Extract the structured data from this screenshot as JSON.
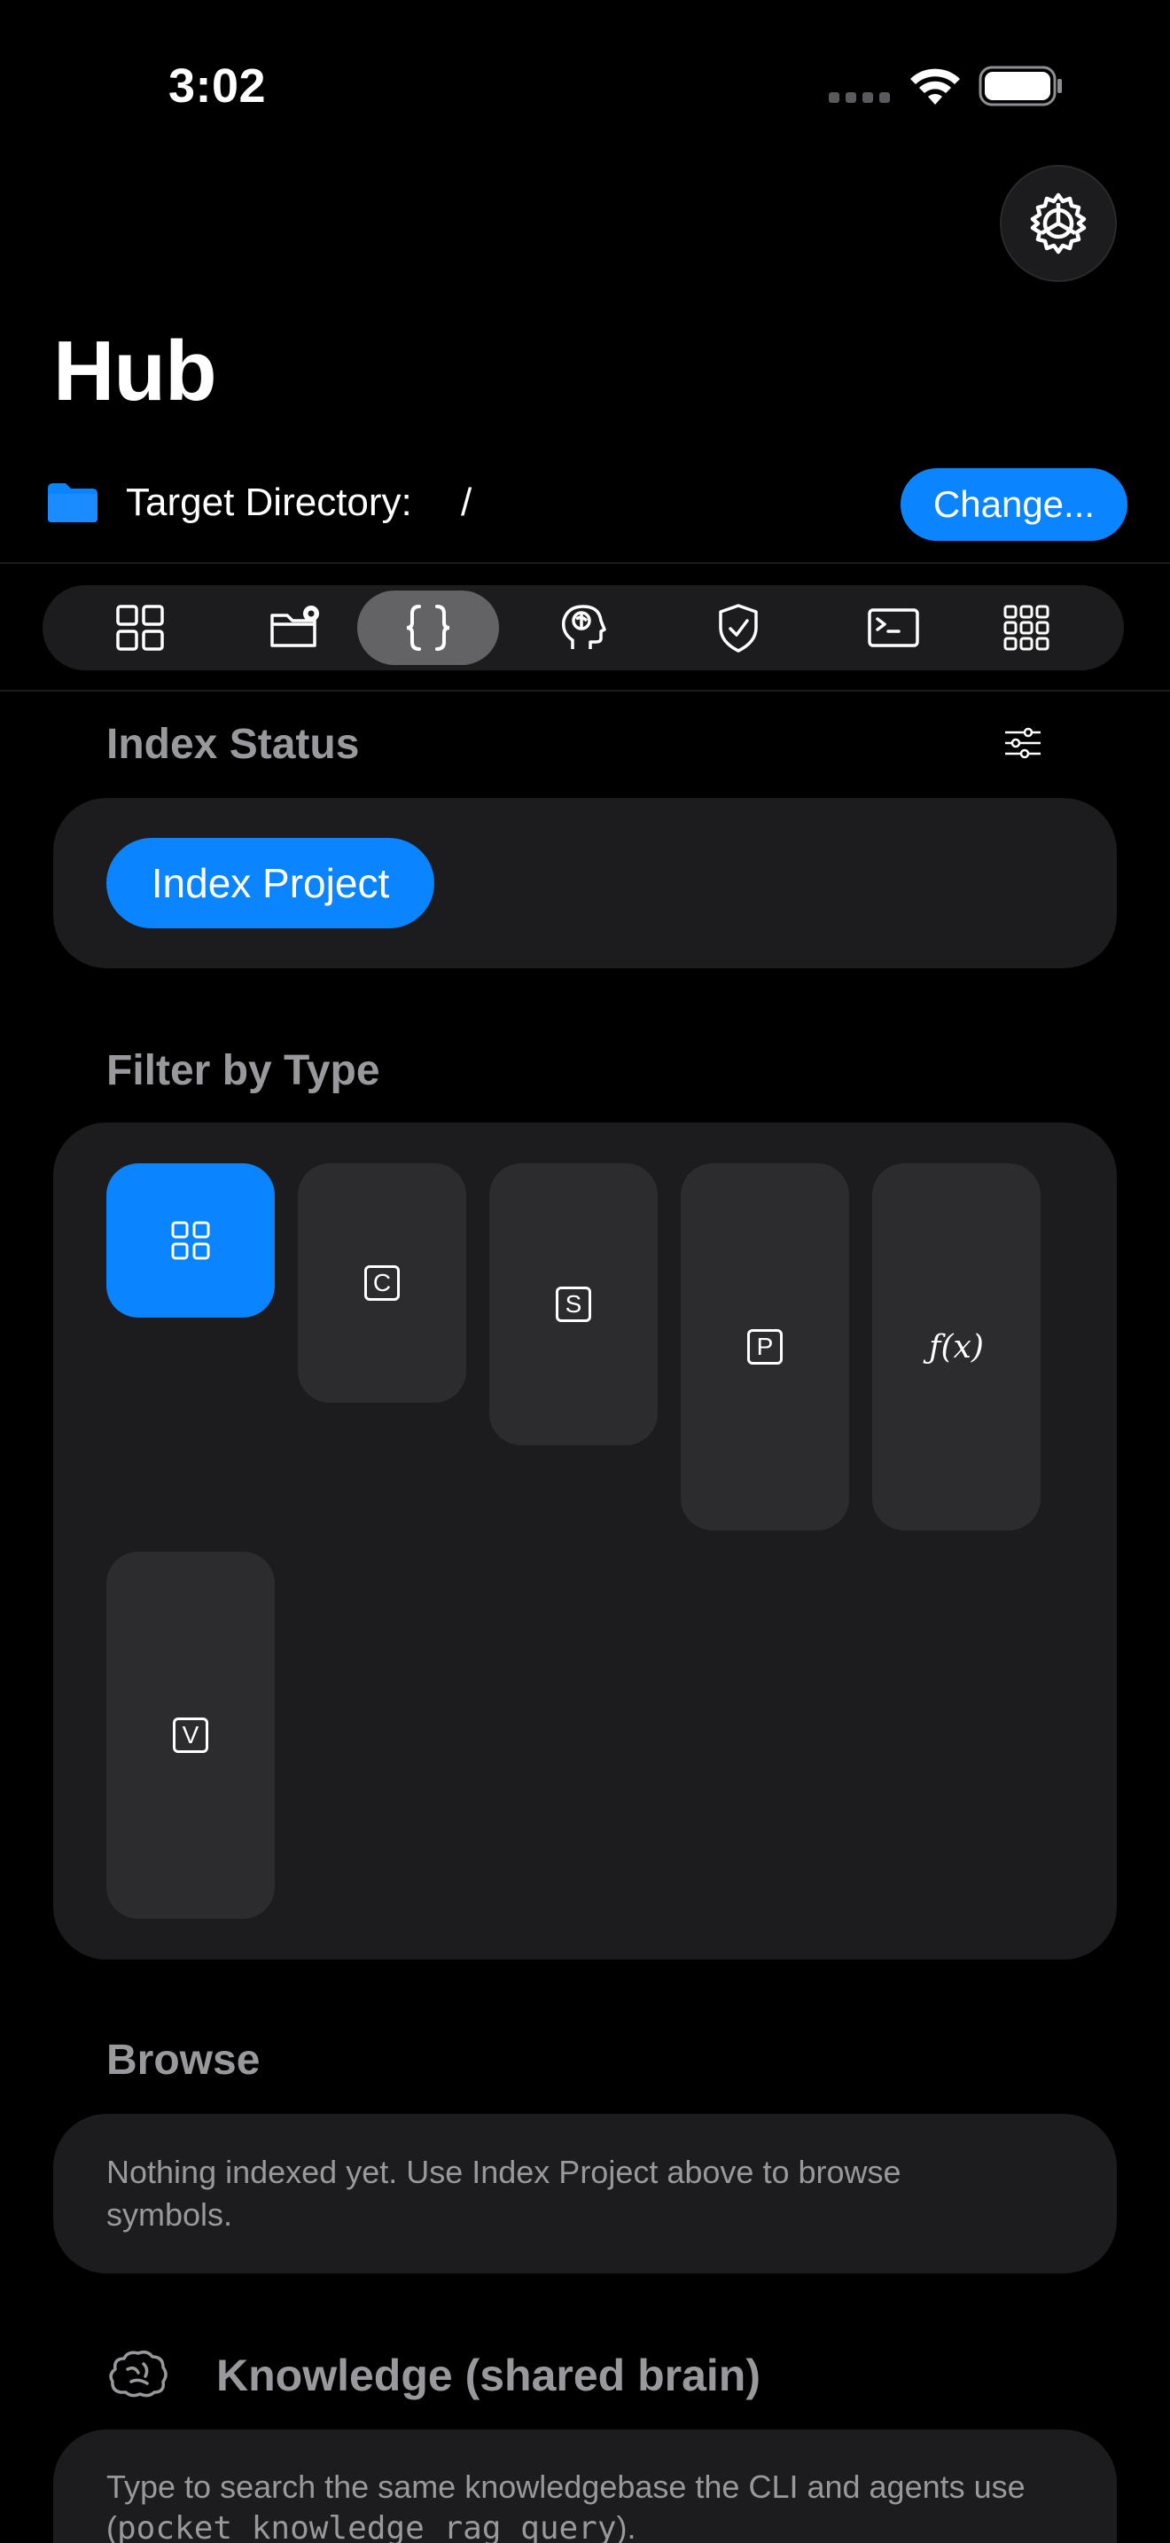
{
  "status_bar": {
    "time": "3:02"
  },
  "header": {
    "title": "Hub",
    "target_label": "Target Directory:",
    "target_path": "/",
    "change_label": "Change..."
  },
  "tabs": [
    {
      "icon": "grid-icon",
      "active": false
    },
    {
      "icon": "folder-gear-icon",
      "active": false
    },
    {
      "icon": "braces-icon",
      "active": true
    },
    {
      "icon": "brain-head-icon",
      "active": false
    },
    {
      "icon": "shield-check-icon",
      "active": false
    },
    {
      "icon": "terminal-icon",
      "active": false
    },
    {
      "icon": "apps-grid-icon",
      "active": false
    }
  ],
  "index_status": {
    "title": "Index Status",
    "button_label": "Index Project"
  },
  "filter": {
    "title": "Filter by Type",
    "chips": [
      {
        "icon": "all-grid-icon",
        "label": "",
        "active": true
      },
      {
        "icon": "letter-box-icon",
        "label": "C",
        "active": false
      },
      {
        "icon": "letter-box-icon",
        "label": "S",
        "active": false
      },
      {
        "icon": "letter-box-icon",
        "label": "P",
        "active": false
      },
      {
        "icon": "function-icon",
        "label": "ƒ(x)",
        "active": false
      },
      {
        "icon": "letter-box-icon",
        "label": "V",
        "active": false
      }
    ]
  },
  "browse": {
    "title": "Browse",
    "empty_text": "Nothing indexed yet. Use Index Project above to browse symbols."
  },
  "knowledge": {
    "title": "Knowledge (shared brain)",
    "description_prefix": "Type to search the same knowledgebase the CLI and agents use (",
    "description_command": "pocket knowledge rag query",
    "description_suffix": ")."
  },
  "colors": {
    "accent": "#0a84ff",
    "card": "#1c1c1e",
    "chip": "#2c2c2e",
    "secondary_text": "#98989d"
  }
}
